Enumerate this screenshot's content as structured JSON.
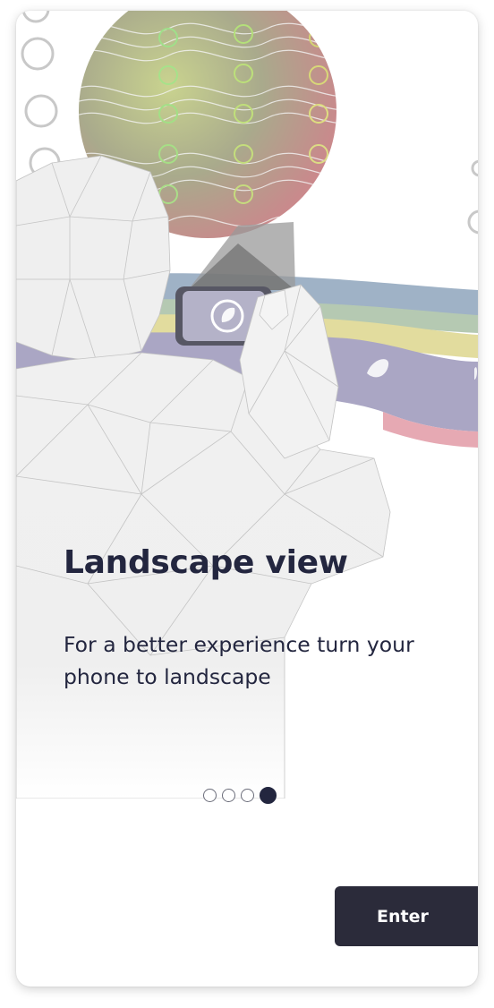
{
  "onboarding": {
    "title": "Landscape view",
    "description": "For a better experience turn your phone to landscape",
    "pager": {
      "total": 4,
      "current": 4
    },
    "enter_label": "Enter"
  },
  "colors": {
    "heading_text": "#23263f",
    "button_bg": "#2b2b3a",
    "button_text": "#ffffff",
    "band_blue": "#9fb2c6",
    "band_green": "#b5c9b2",
    "band_yellow": "#e2dc9e",
    "band_purple": "#aaa6c4",
    "band_pink": "#e6a9b3"
  },
  "illustration": {
    "name": "person-holding-phone-landscape-illustration"
  }
}
